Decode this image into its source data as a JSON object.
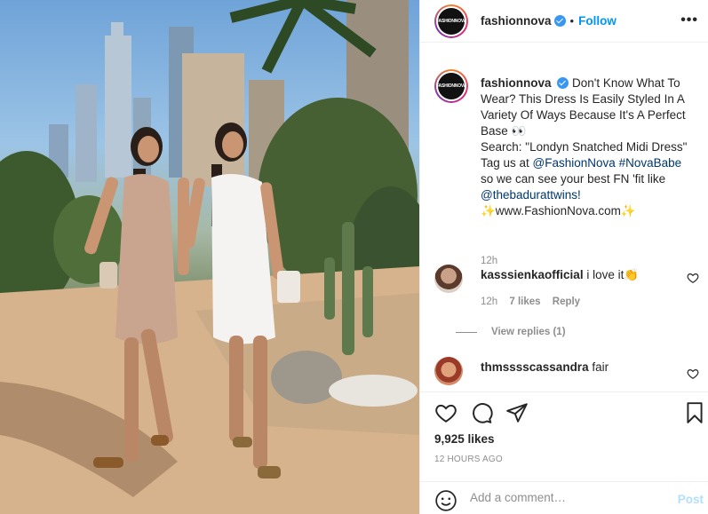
{
  "post": {
    "username": "fashionnova",
    "separator": "•",
    "follow_label": "Follow",
    "more_label": "•••",
    "avatar_text": "FASHIONNOVA",
    "caption": {
      "username": "fashionnova",
      "line1": "Don't Know What To Wear? This Dress Is Easily Styled In A Variety Of Ways Because It's A Perfect Base 👀",
      "search_line": "Search: \"Londyn Snatched Midi Dress\"",
      "tag_prefix": "Tag us at ",
      "tag_link1": "@FashionNova",
      "tag_link2": "#NovaBabe",
      "fit_line": "so we can see your best FN 'fit like",
      "fit_link": "@thebadurattwins!",
      "site_line": "✨www.FashionNova.com✨",
      "time": "12h"
    },
    "comments": [
      {
        "username": "kasssienkaofficial",
        "text": "i love it👏",
        "time": "12h",
        "likes": "7 likes",
        "reply": "Reply",
        "view_replies": "View replies (1)"
      },
      {
        "username": "thmsssscassandra",
        "text": "fair"
      }
    ],
    "likes_count": "9,925 likes",
    "posted_ago": "12 HOURS AGO",
    "comment_placeholder": "Add a comment…",
    "post_label": "Post"
  },
  "icons": {
    "like": "heart-icon",
    "comment": "comment-icon",
    "share": "share-icon",
    "save": "bookmark-icon",
    "emoji": "smiley-icon",
    "verified": "verified-badge-icon"
  },
  "colors": {
    "link": "#00376b",
    "follow": "#0095f6",
    "muted": "#8e8e8e",
    "verified": "#3897f0",
    "post_disabled": "#b2dffc"
  }
}
